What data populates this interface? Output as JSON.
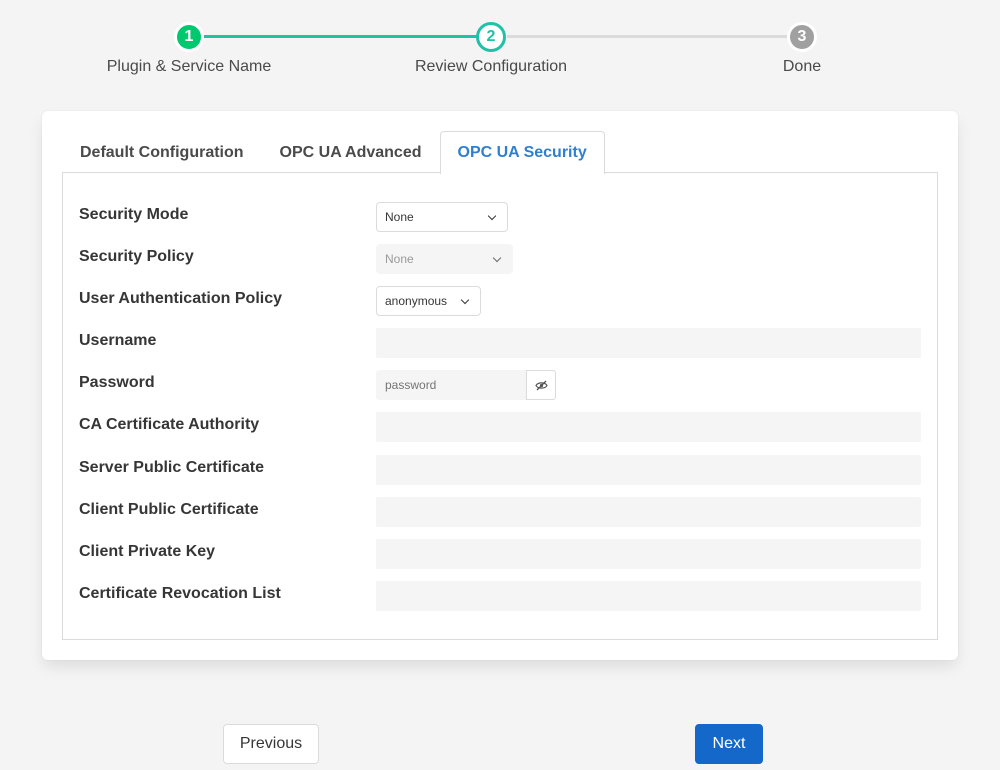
{
  "stepper": {
    "steps": [
      {
        "number": "1",
        "label": "Plugin & Service Name"
      },
      {
        "number": "2",
        "label": "Review Configuration"
      },
      {
        "number": "3",
        "label": "Done"
      }
    ],
    "colors": {
      "complete": "#00c86e",
      "active": "#1fc1a7",
      "pending": "#a0a0a0"
    }
  },
  "tabs": [
    {
      "label": "Default Configuration"
    },
    {
      "label": "OPC UA Advanced"
    },
    {
      "label": "OPC UA Security"
    }
  ],
  "form": {
    "security_mode": {
      "label": "Security Mode",
      "value": "None"
    },
    "security_policy": {
      "label": "Security Policy",
      "value": "None"
    },
    "user_auth_policy": {
      "label": "User Authentication Policy",
      "value": "anonymous"
    },
    "username": {
      "label": "Username",
      "value": ""
    },
    "password": {
      "label": "Password",
      "placeholder": "password",
      "value": ""
    },
    "ca_certificate": {
      "label": "CA Certificate Authority",
      "value": ""
    },
    "server_certificate": {
      "label": "Server Public Certificate",
      "value": ""
    },
    "client_certificate": {
      "label": "Client Public Certificate",
      "value": ""
    },
    "client_private_key": {
      "label": "Client Private Key",
      "value": ""
    },
    "revocation_list": {
      "label": "Certificate Revocation List",
      "value": ""
    }
  },
  "buttons": {
    "previous": "Previous",
    "next": "Next"
  },
  "accent_color": "#1468c9",
  "active_tab_color": "#2f7fd1"
}
